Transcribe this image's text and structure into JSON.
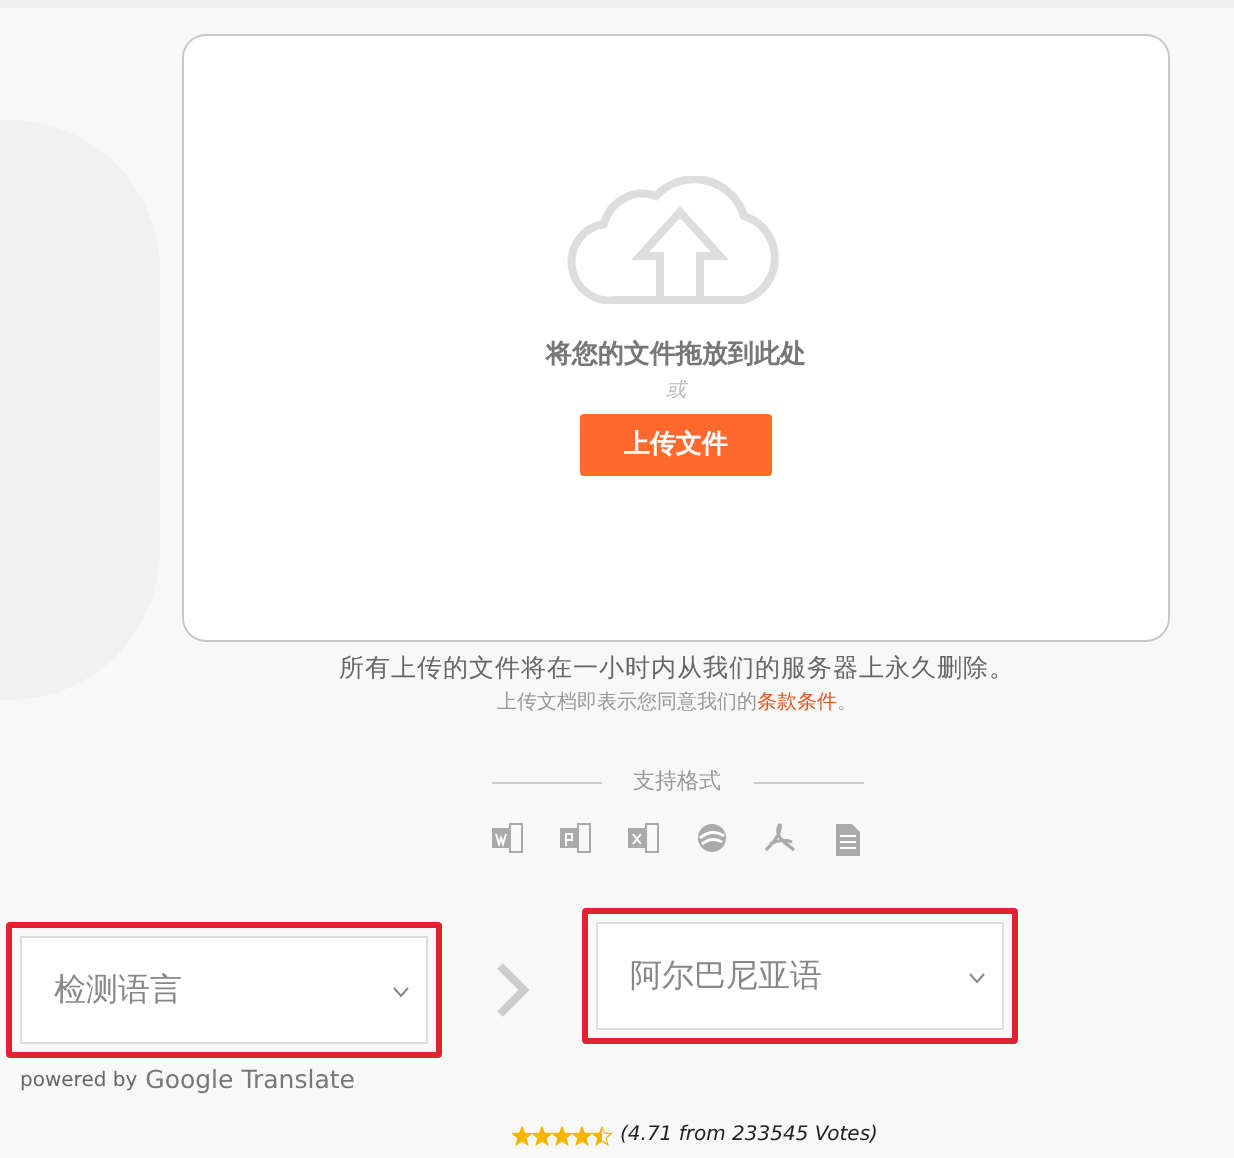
{
  "dropzone": {
    "heading": "将您的文件拖放到此处",
    "or": "或",
    "upload_button": "上传文件"
  },
  "notice": "所有上传的文件将在一小时内从我们的服务器上永久删除。",
  "terms": {
    "text": "上传文档即表示您同意我们的",
    "link": "条款条件",
    "end": "。"
  },
  "formats": {
    "label": "支持格式"
  },
  "source_language": {
    "value": "检测语言",
    "highlighted": true
  },
  "target_language": {
    "value": "阿尔巴尼亚语",
    "highlighted": true
  },
  "powered_by": {
    "prefix": "powered by",
    "brand": "Google Translate"
  },
  "rating": {
    "stars": 4.5,
    "text": "(4.71 from 233545 Votes)"
  }
}
